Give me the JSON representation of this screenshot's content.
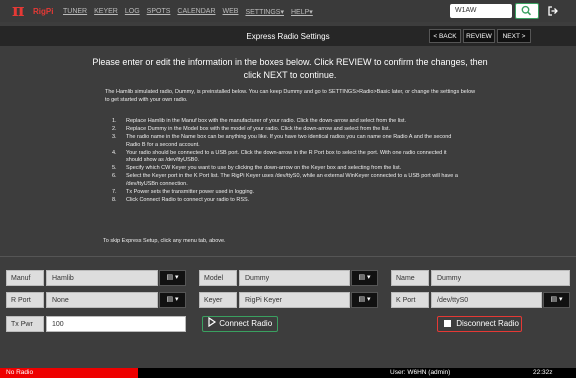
{
  "nav": {
    "logo": "π",
    "brand": "RigPi",
    "items": [
      "TUNER",
      "KEYER",
      "LOG",
      "SPOTS",
      "CALENDAR",
      "WEB",
      "SETTINGS▾",
      "HELP▾"
    ],
    "search_value": "W1AW",
    "search_icon": "search-icon",
    "logout_icon": "logout-icon"
  },
  "header": {
    "title": "Express Radio Settings",
    "back": "< BACK",
    "review": "REVIEW",
    "next": "NEXT >"
  },
  "lead": "Please enter or edit the information in the boxes below. Click REVIEW to confirm the changes, then click NEXT to continue.",
  "intro": "The Hamlib simulated radio, Dummy, is preinstalled below. You can keep Dummy and go to SETTINGS>Radio>Basic later, or change the settings below to get started with your own radio.",
  "steps": [
    {
      "n": "1.",
      "text": "Replace Hamlib in the Manuf box with the manufacturer of your radio. Click the down-arrow and select from the list."
    },
    {
      "n": "2.",
      "text": "Replace Dummy in the Model box with the model of your radio. Click the down-arrow and select from the list."
    },
    {
      "n": "3.",
      "text": "The radio name in the Name box can be anything you like. If you have two identical radios you can name one Radio A and the second Radio B for a second account."
    },
    {
      "n": "4.",
      "text": "Your radio should be connected to a USB port. Click the down-arrow in the R Port box to select the port. With one radio connected it should show as /dev/ttyUSB0."
    },
    {
      "n": "5.",
      "text": "Specify which CW Keyer you want to use by clicking the down-arrow on the Keyer box and selecting from the list."
    },
    {
      "n": "6.",
      "text": "Select the Keyer port in the K Port list. The RigPi Keyer uses /dev/ttyS0, while an external WinKeyer connected to a USB port will have a /dev/ttyUSBn connection."
    },
    {
      "n": "7.",
      "text": "Tx Power sets the transmitter power used in logging."
    },
    {
      "n": "8.",
      "text": "Click Connect Radio to connect your radio to RSS."
    }
  ],
  "skip": "To skip Express Setup, click any menu tab, above.",
  "form": {
    "manuf_label": "Manuf",
    "manuf_value": "Hamlib",
    "model_label": "Model",
    "model_value": "Dummy",
    "name_label": "Name",
    "name_value": "Dummy",
    "rport_label": "R Port",
    "rport_value": "None",
    "keyer_label": "Keyer",
    "keyer_value": "RigPi Keyer",
    "kport_label": "K Port",
    "kport_value": "/dev/ttyS0",
    "txpwr_label": "Tx Pwr",
    "txpwr_value": "100",
    "dropdown_glyph": "▤ ▾",
    "connect": "Connect Radio",
    "disconnect": "Disconnect Radio"
  },
  "footer": {
    "radio_status": "No Radio",
    "user": "User: W6HN (admin)",
    "time": "22:32z"
  },
  "colors": {
    "accent_red": "#e53935",
    "green": "#3aa060",
    "status_red": "#ee0000"
  }
}
